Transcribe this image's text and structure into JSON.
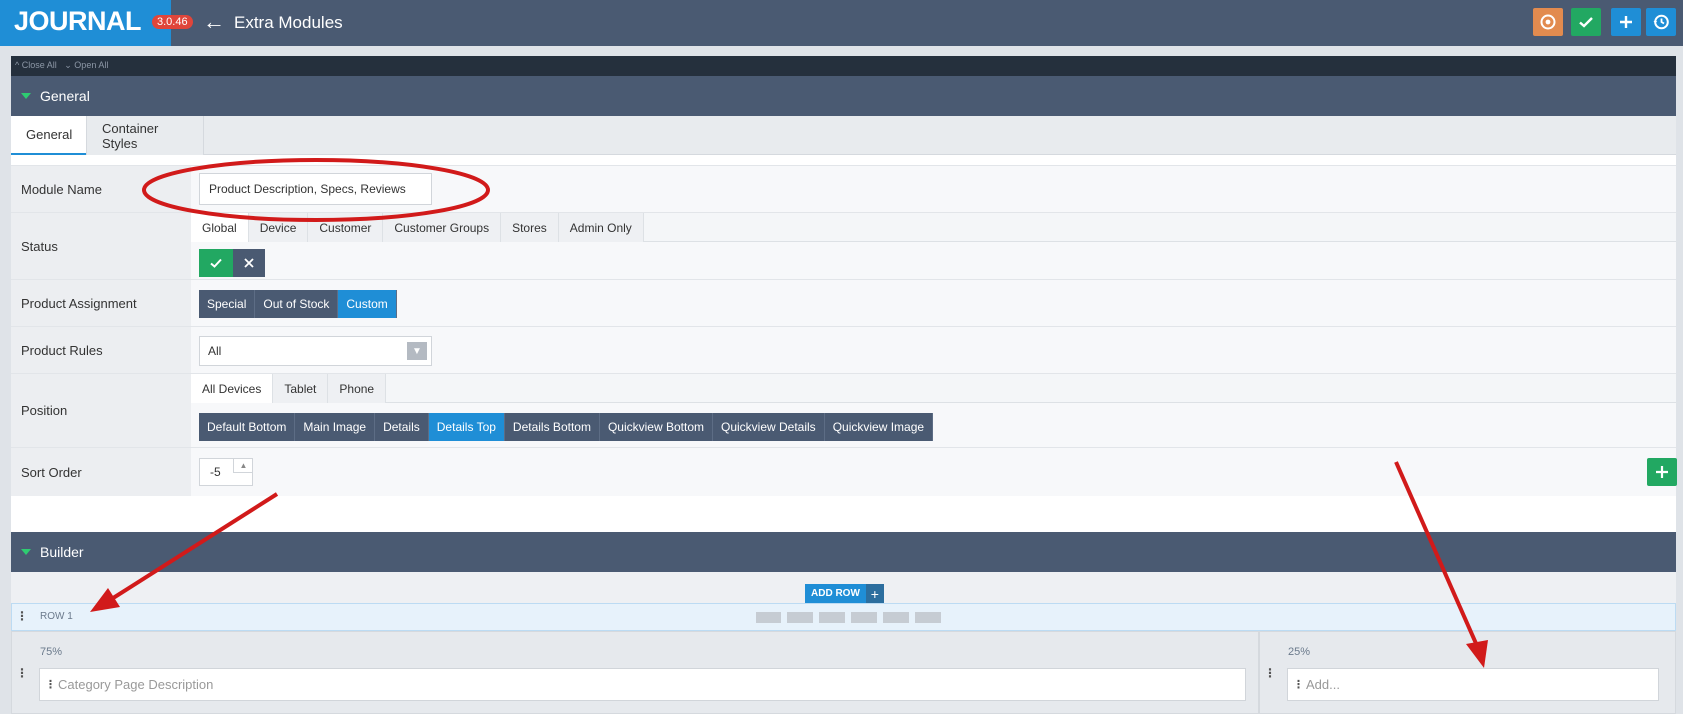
{
  "header": {
    "logo": "JOURNAL",
    "version": "3.0.46",
    "title": "Extra Modules",
    "actions": {
      "cache_icon": "refresh-gear-icon",
      "save_icon": "check-icon",
      "add_icon": "plus-icon",
      "history_icon": "history-icon"
    }
  },
  "toolbar": {
    "close_all": "^ Close All",
    "open_all": "⌄ Open All"
  },
  "sections": {
    "general": "General",
    "builder": "Builder"
  },
  "main_tabs": [
    {
      "label": "General"
    },
    {
      "label": "Container Styles"
    }
  ],
  "form": {
    "module_name": {
      "label": "Module Name",
      "value": "Product Description, Specs, Reviews"
    },
    "status": {
      "label": "Status",
      "tabs": [
        "Global",
        "Device",
        "Customer",
        "Customer Groups",
        "Stores",
        "Admin Only"
      ]
    },
    "product_assignment": {
      "label": "Product Assignment",
      "options": [
        "Special",
        "Out of Stock",
        "Custom"
      ],
      "selected": "Custom"
    },
    "product_rules": {
      "label": "Product Rules",
      "value": "All"
    },
    "position": {
      "label": "Position",
      "tabs": [
        "All Devices",
        "Tablet",
        "Phone"
      ],
      "options": [
        "Default Bottom",
        "Main Image",
        "Details",
        "Details Top",
        "Details Bottom",
        "Quickview Bottom",
        "Quickview Details",
        "Quickview Image"
      ],
      "selected": "Details Top"
    },
    "sort_order": {
      "label": "Sort Order",
      "value": "-5"
    }
  },
  "builder": {
    "add_row": "ADD ROW",
    "row_title": "ROW 1",
    "columns": [
      {
        "width": "75%",
        "placeholder": "Category Page Description"
      },
      {
        "width": "25%",
        "placeholder": "Add..."
      }
    ]
  },
  "colors": {
    "accent": "#1f8ed6",
    "success": "#22a862",
    "header": "#4a5a72",
    "annotation": "#d11a1a"
  }
}
